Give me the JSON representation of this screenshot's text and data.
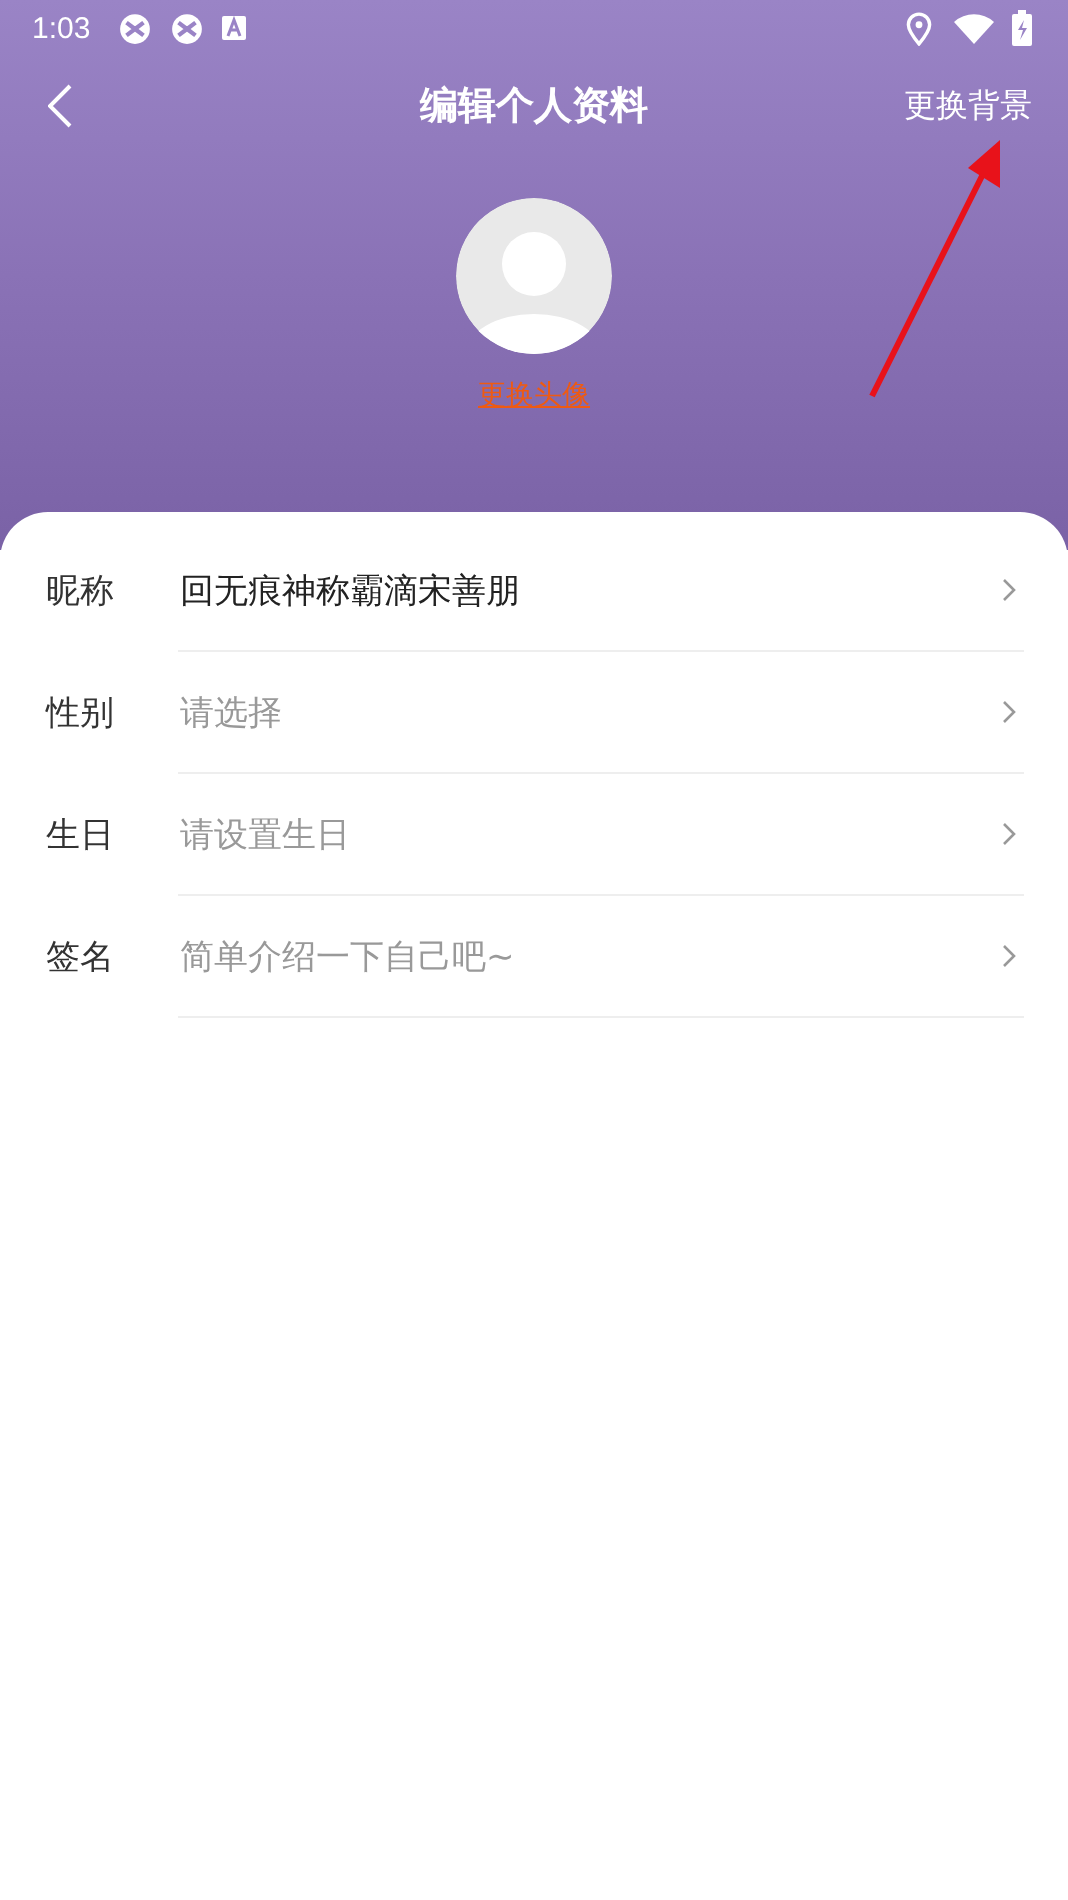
{
  "status_bar": {
    "time": "1:03"
  },
  "nav": {
    "title": "编辑个人资料",
    "action": "更换背景"
  },
  "avatar": {
    "link": "更换头像"
  },
  "fields": [
    {
      "label": "昵称",
      "value": "回无痕神称霸滴宋善朋"
    },
    {
      "label": "性别",
      "placeholder": "请选择"
    },
    {
      "label": "生日",
      "placeholder": "请设置生日"
    },
    {
      "label": "签名",
      "placeholder": "简单介绍一下自己吧~"
    }
  ]
}
